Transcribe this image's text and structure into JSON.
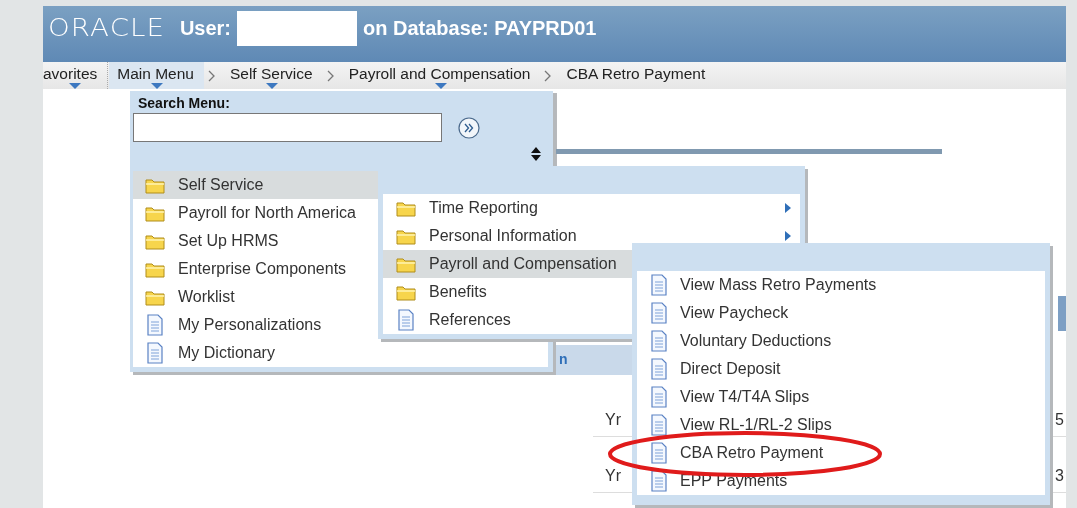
{
  "header": {
    "logo": "ORACLE",
    "user_label": "User:",
    "database_label": "on Database: PAYPRD01"
  },
  "breadcrumbs": [
    {
      "label": "avorites",
      "dropdown": true,
      "selected": false
    },
    {
      "label": "Main Menu",
      "dropdown": true,
      "selected": true
    },
    {
      "label": "Self Service",
      "dropdown": true,
      "selected": false
    },
    {
      "label": "Payroll and Compensation",
      "dropdown": true,
      "selected": false
    },
    {
      "label": "CBA Retro Payment",
      "dropdown": false,
      "selected": false
    }
  ],
  "search_menu": {
    "label": "Search Menu:"
  },
  "menus": [
    {
      "items": [
        {
          "label": "Self Service",
          "kind": "folder",
          "selected": true,
          "arrow": false,
          "circled": false
        },
        {
          "label": "Payroll for North America",
          "kind": "folder",
          "selected": false,
          "arrow": false,
          "circled": false
        },
        {
          "label": "Set Up HRMS",
          "kind": "folder",
          "selected": false,
          "arrow": false,
          "circled": false
        },
        {
          "label": "Enterprise Components",
          "kind": "folder",
          "selected": false,
          "arrow": false,
          "circled": false
        },
        {
          "label": "Worklist",
          "kind": "folder",
          "selected": false,
          "arrow": false,
          "circled": false
        },
        {
          "label": "My Personalizations",
          "kind": "page",
          "selected": false,
          "arrow": false,
          "circled": false
        },
        {
          "label": "My Dictionary",
          "kind": "page",
          "selected": false,
          "arrow": false,
          "circled": false
        }
      ]
    },
    {
      "items": [
        {
          "label": "Time Reporting",
          "kind": "folder",
          "selected": false,
          "arrow": true,
          "circled": false
        },
        {
          "label": "Personal Information",
          "kind": "folder",
          "selected": false,
          "arrow": true,
          "circled": false
        },
        {
          "label": "Payroll and Compensation",
          "kind": "folder",
          "selected": true,
          "arrow": false,
          "circled": false
        },
        {
          "label": "Benefits",
          "kind": "folder",
          "selected": false,
          "arrow": false,
          "circled": false
        },
        {
          "label": "References",
          "kind": "page",
          "selected": false,
          "arrow": false,
          "circled": false
        }
      ]
    },
    {
      "items": [
        {
          "label": "View Mass Retro Payments",
          "kind": "page",
          "selected": false,
          "arrow": false,
          "circled": false
        },
        {
          "label": "View Paycheck",
          "kind": "page",
          "selected": false,
          "arrow": false,
          "circled": false
        },
        {
          "label": "Voluntary Deductions",
          "kind": "page",
          "selected": false,
          "arrow": false,
          "circled": false
        },
        {
          "label": "Direct Deposit",
          "kind": "page",
          "selected": false,
          "arrow": false,
          "circled": false
        },
        {
          "label": "View T4/T4A Slips",
          "kind": "page",
          "selected": false,
          "arrow": false,
          "circled": false
        },
        {
          "label": "View RL-1/RL-2 Slips",
          "kind": "page",
          "selected": false,
          "arrow": false,
          "circled": false
        },
        {
          "label": "CBA Retro Payment",
          "kind": "page",
          "selected": false,
          "arrow": false,
          "circled": true
        },
        {
          "label": "EPP Payments",
          "kind": "page",
          "selected": false,
          "arrow": false,
          "circled": false
        }
      ]
    }
  ],
  "background_page": {
    "link_fragment": "n",
    "rows": [
      {
        "column_1": "Yr",
        "column_2": "5"
      },
      {
        "column_1": "Yr",
        "column_2": "3"
      }
    ]
  }
}
